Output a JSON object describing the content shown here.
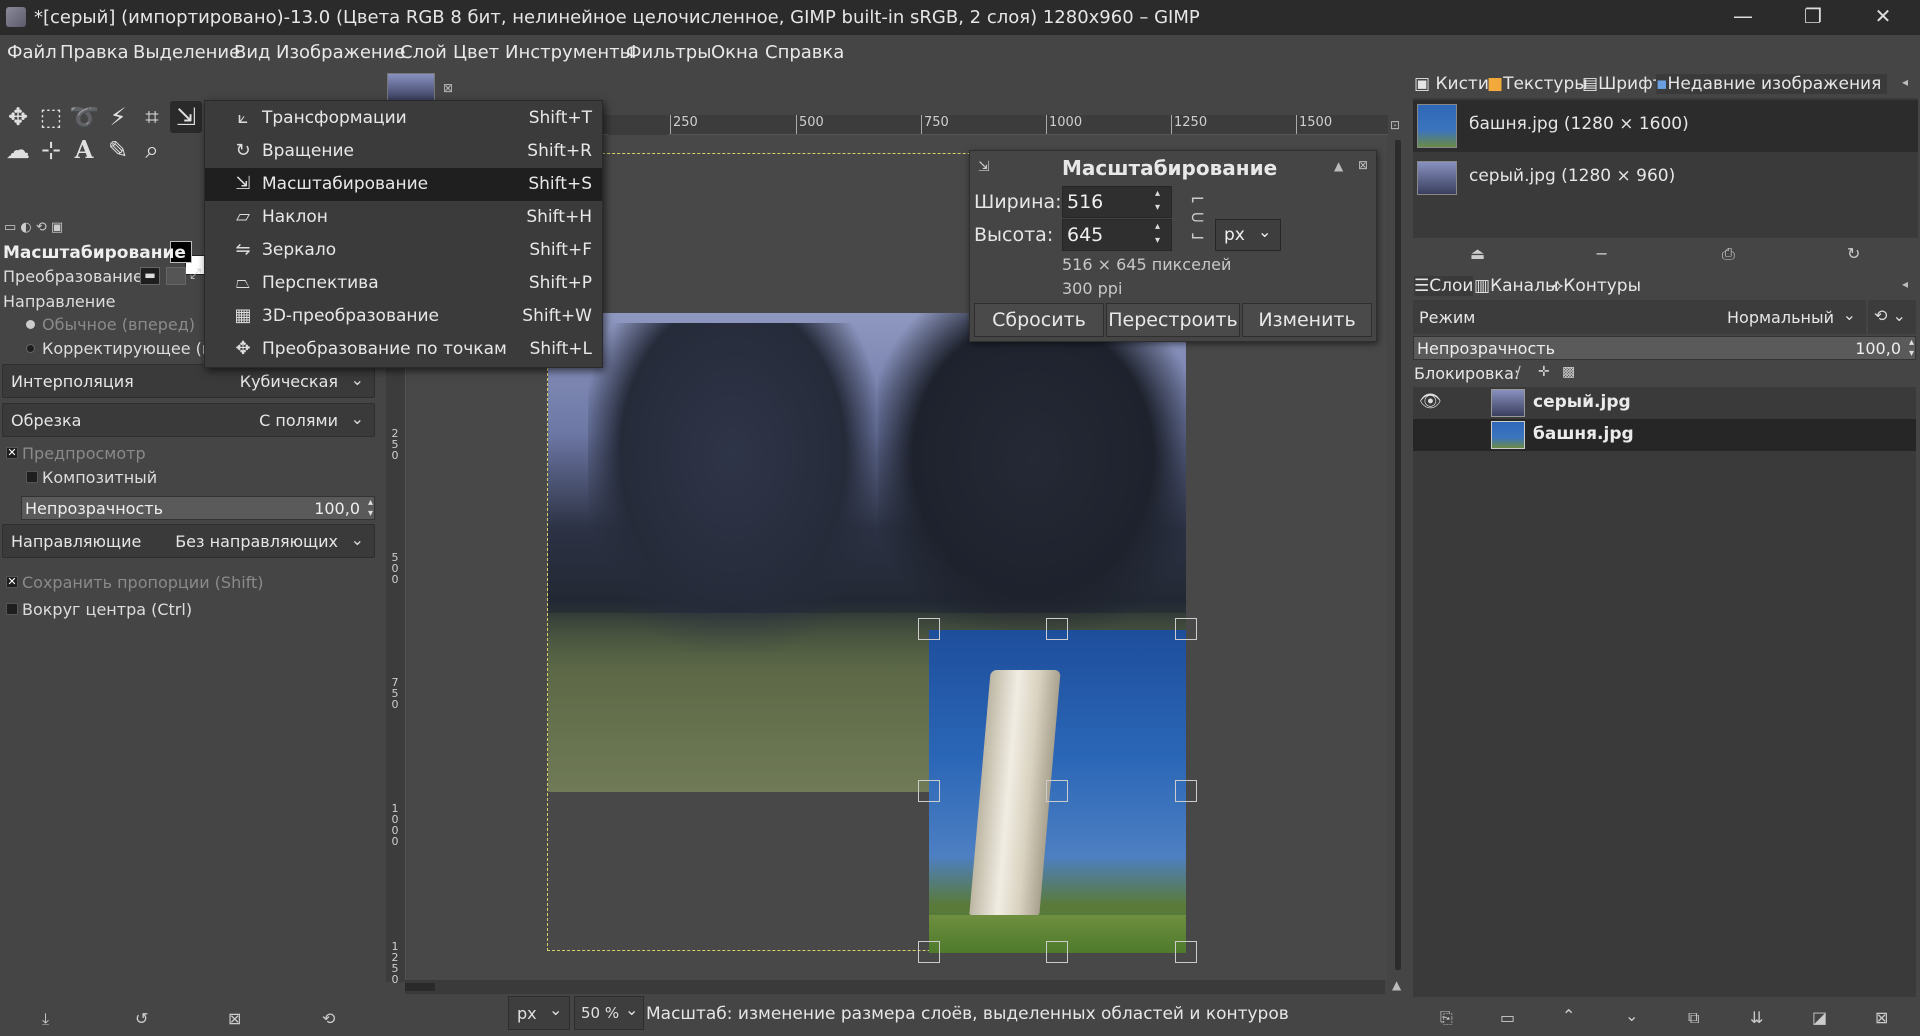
{
  "window": {
    "title": "*[серый] (импортировано)-13.0 (Цвета RGB 8 бит, нелинейное целочисленное, GIMP built-in sRGB, 2 слоя) 1280x960 – GIMP",
    "minimize": "—",
    "maximize": "❐",
    "close": "✕"
  },
  "menubar": [
    "Файл",
    "Правка",
    "Выделение",
    "Вид",
    "Изображение",
    "Слой",
    "Цвет",
    "Инструменты",
    "Фильтры",
    "Окна",
    "Справка"
  ],
  "tool_options": {
    "title": "Масштабирование",
    "transform_label": "Преобразование:",
    "direction_label": "Направление",
    "direction_normal": "Обычное (вперед)",
    "direction_corrective": "Корректирующее (на",
    "interpolation_label": "Интерполяция",
    "interpolation_value": "Кубическая",
    "clipping_label": "Обрезка",
    "clipping_value": "С полями",
    "preview_label": "Предпросмотр",
    "composite_label": "Композитный",
    "opacity_label": "Непрозрачность",
    "opacity_value": "100,0",
    "guides_label": "Направляющие",
    "guides_value": "Без направляющих",
    "keep_aspect_label": "Сохранить пропорции  (Shift)",
    "around_center_label": "Вокруг центра (Ctrl)"
  },
  "transform_menu": [
    {
      "icon": "transform-icon",
      "glyph": "⟀",
      "label": "Трансформации",
      "shortcut": "Shift+T"
    },
    {
      "icon": "rotate-icon",
      "glyph": "↻",
      "label": "Вращение",
      "shortcut": "Shift+R"
    },
    {
      "icon": "scale-icon",
      "glyph": "⇲",
      "label": "Масштабирование",
      "shortcut": "Shift+S"
    },
    {
      "icon": "shear-icon",
      "glyph": "▱",
      "label": "Наклон",
      "shortcut": "Shift+H"
    },
    {
      "icon": "flip-icon",
      "glyph": "⇋",
      "label": "Зеркало",
      "shortcut": "Shift+F"
    },
    {
      "icon": "perspective-icon",
      "glyph": "⏢",
      "label": "Перспектива",
      "shortcut": "Shift+P"
    },
    {
      "icon": "3d-transform-icon",
      "glyph": "▦",
      "label": "3D-преобразование",
      "shortcut": "Shift+W"
    },
    {
      "icon": "handle-transform-icon",
      "glyph": "✥",
      "label": "Преобразование по точкам",
      "shortcut": "Shift+L"
    }
  ],
  "scale_dialog": {
    "title": "Масштабирование",
    "width_label": "Ширина:",
    "width_value": "516",
    "height_label": "Высота:",
    "height_value": "645",
    "unit": "px",
    "size_info": "516 × 645 пикселей",
    "resolution_info": "300 ppi",
    "reset_button": "Сбросить",
    "readjust_button": "Перестроить",
    "scale_button": "Изменить"
  },
  "ruler": {
    "top_ticks": [
      "250",
      "500",
      "750",
      "1000",
      "1250",
      "1500"
    ],
    "left_ticks": [
      "2\n5\n0",
      "5\n0\n0",
      "7\n5\n0",
      "1\n0\n0\n0",
      "1\n2\n5\n0"
    ]
  },
  "statusbar": {
    "unit": "px",
    "zoom": "50 %",
    "message": "Масштаб: изменение размера слоёв, выделенных областей и контуров"
  },
  "right_dock": {
    "top_tabs": [
      "Кисти",
      "Текстуры",
      "Шрифты",
      "Недавние изображения"
    ],
    "recent_images": [
      {
        "label": "башня.jpg (1280 × 1600)"
      },
      {
        "label": "серый.jpg (1280 × 960)"
      }
    ],
    "layer_tabs": [
      "Слои",
      "Каналы",
      "Контуры"
    ],
    "mode_label": "Режим",
    "mode_value": "Нормальный",
    "opacity_label": "Непрозрачность",
    "opacity_value": "100,0",
    "lock_label": "Блокировка:",
    "layers": [
      {
        "name": "серый.jpg"
      },
      {
        "name": "башня.jpg"
      }
    ]
  },
  "colors": {
    "selection_highlight": "#1f1f1f",
    "canvas_border": "#d6d06a"
  }
}
